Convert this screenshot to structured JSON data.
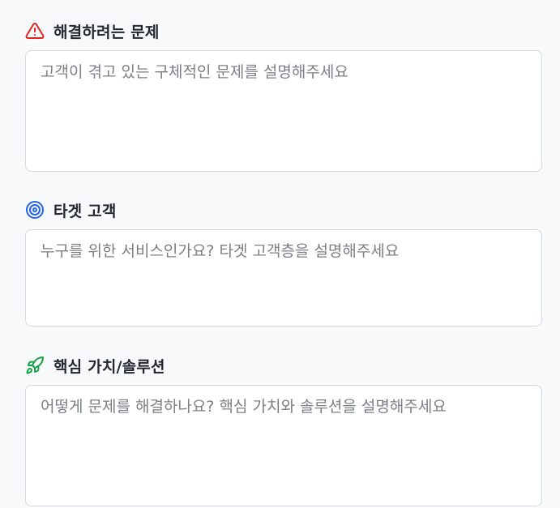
{
  "sections": [
    {
      "icon": "warning-triangle-icon",
      "icon_color": "#dc2626",
      "label": "해결하려는 문제",
      "placeholder": "고객이 겪고 있는 구체적인 문제를 설명해주세요",
      "value": ""
    },
    {
      "icon": "target-icon",
      "icon_color": "#2563eb",
      "label": "타겟 고객",
      "placeholder": "누구를 위한 서비스인가요? 타겟 고객층을 설명해주세요",
      "value": ""
    },
    {
      "icon": "rocket-icon",
      "icon_color": "#16a34a",
      "label": "핵심 가치/솔루션",
      "placeholder": "어떻게 문제를 해결하나요? 핵심 가치와 솔루션을 설명해주세요",
      "value": ""
    }
  ]
}
